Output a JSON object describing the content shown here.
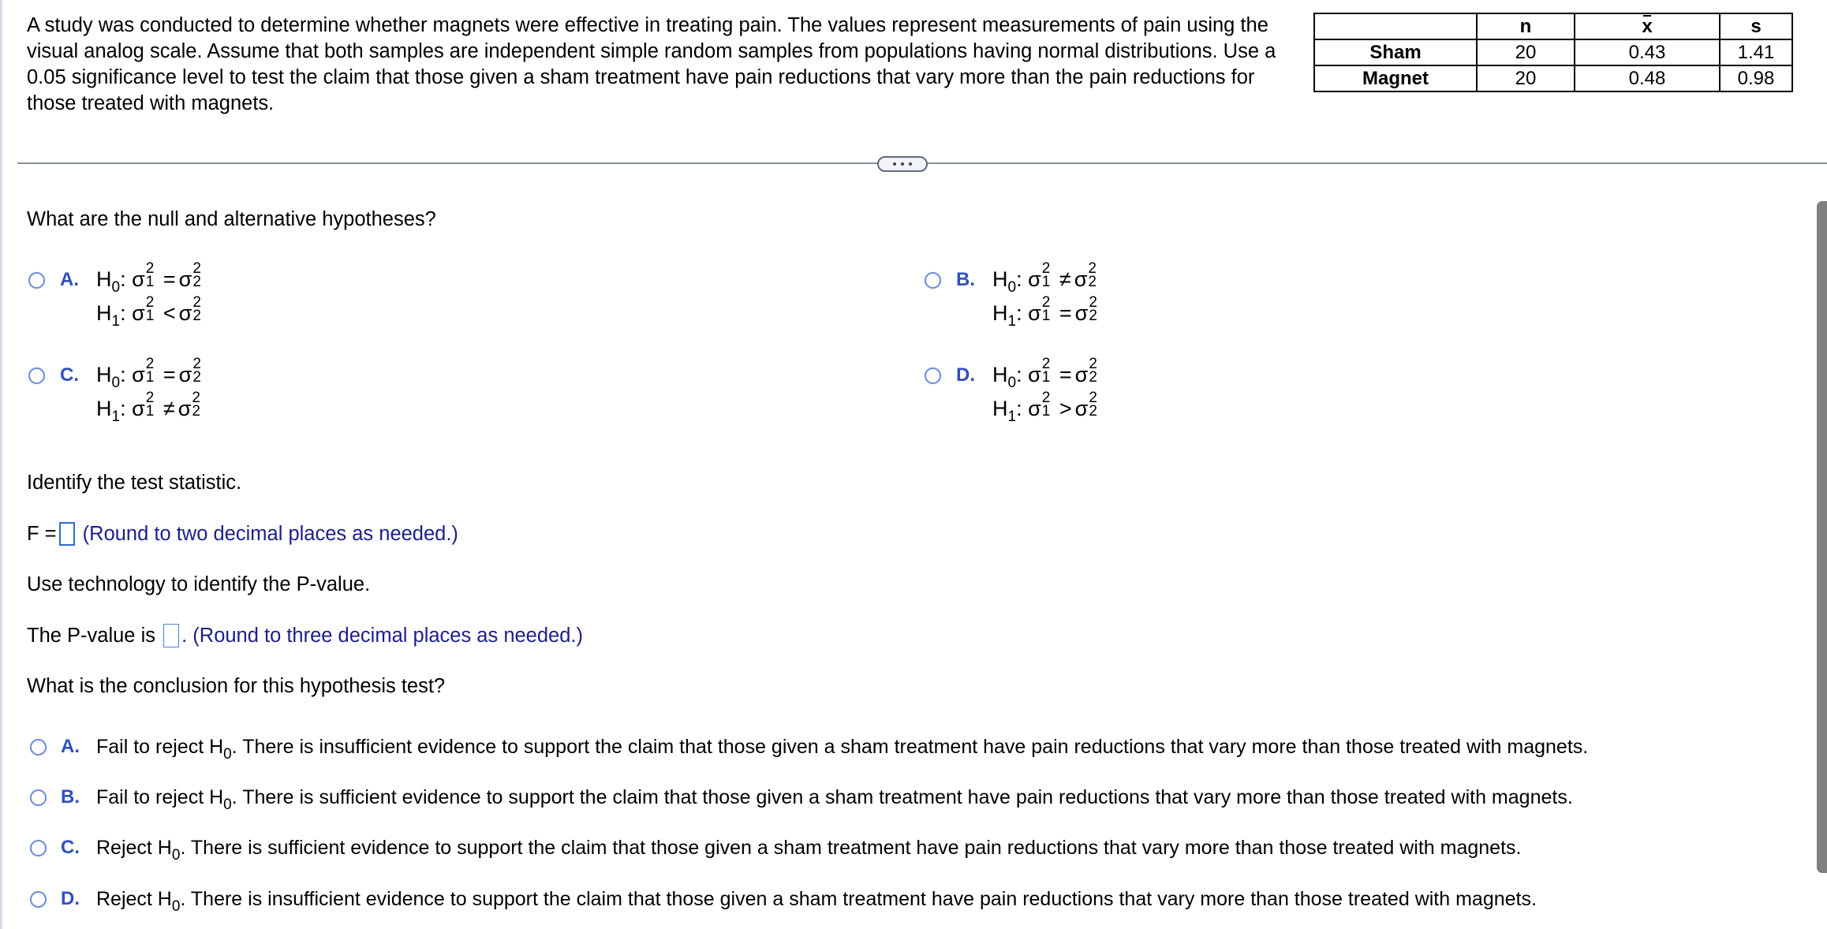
{
  "problem": {
    "text_lines": [
      "A study was conducted to determine whether magnets were effective in treating pain. The values represent measurements of pain using the",
      "visual analog scale. Assume that both samples are independent simple random samples from populations having normal distributions. Use a",
      "0.05 significance level to test the claim that those given a sham treatment have pain reductions that vary more than the pain reductions for",
      "those treated with magnets."
    ]
  },
  "data_table": {
    "headers": [
      "",
      "n",
      "x",
      "s"
    ],
    "rows": [
      {
        "label": "Sham",
        "n": "20",
        "xbar": "0.43",
        "s": "1.41"
      },
      {
        "label": "Magnet",
        "n": "20",
        "xbar": "0.48",
        "s": "0.98"
      }
    ]
  },
  "divider": {
    "expand_icon": "ellipsis-icon"
  },
  "hypotheses": {
    "question": "What are the null and alternative hypotheses?",
    "options": [
      {
        "letter": "A.",
        "h0_rel": "=",
        "h1_rel": "<"
      },
      {
        "letter": "B.",
        "h0_rel": "≠",
        "h1_rel": "="
      },
      {
        "letter": "C.",
        "h0_rel": "=",
        "h1_rel": "≠"
      },
      {
        "letter": "D.",
        "h0_rel": "=",
        "h1_rel": ">"
      }
    ],
    "symbols": {
      "H": "H",
      "sub0": "0",
      "sub1": "1",
      "colon": ":",
      "sigma": "σ",
      "sup": "2",
      "s1": "1",
      "s2": "2"
    }
  },
  "test_statistic": {
    "prompt": "Identify the test statistic.",
    "label": "F =",
    "value": "",
    "hint": "(Round to two decimal places as needed.)"
  },
  "p_value": {
    "prompt": "Use technology to identify the P-value.",
    "label": "The P-value is",
    "value": "",
    "after": ".",
    "hint": "(Round to three decimal places as needed.)"
  },
  "conclusion": {
    "question": "What is the conclusion for this hypothesis test?",
    "options": [
      {
        "letter": "A.",
        "pre": "Fail to reject H",
        "sub": "0",
        "post": ". There is insufficient evidence to support the claim that those given a sham treatment have pain reductions that vary more than those treated with magnets."
      },
      {
        "letter": "B.",
        "pre": "Fail to reject H",
        "sub": "0",
        "post": ". There is sufficient evidence to support the claim that those given a sham treatment have pain reductions that vary more than those treated with magnets."
      },
      {
        "letter": "C.",
        "pre": "Reject H",
        "sub": "0",
        "post": ". There is sufficient evidence to support the claim that those given a sham treatment have pain reductions that vary more than those treated with magnets."
      },
      {
        "letter": "D.",
        "pre": "Reject H",
        "sub": "0",
        "post": ". There is insufficient evidence to support the claim that those given a sham treatment have pain reductions that vary more than those treated with magnets."
      }
    ]
  },
  "colors": {
    "accent": "#2f4fc0",
    "hint": "#1b1f8a",
    "input_border": "#2e6cd1",
    "divider": "#868e99"
  }
}
